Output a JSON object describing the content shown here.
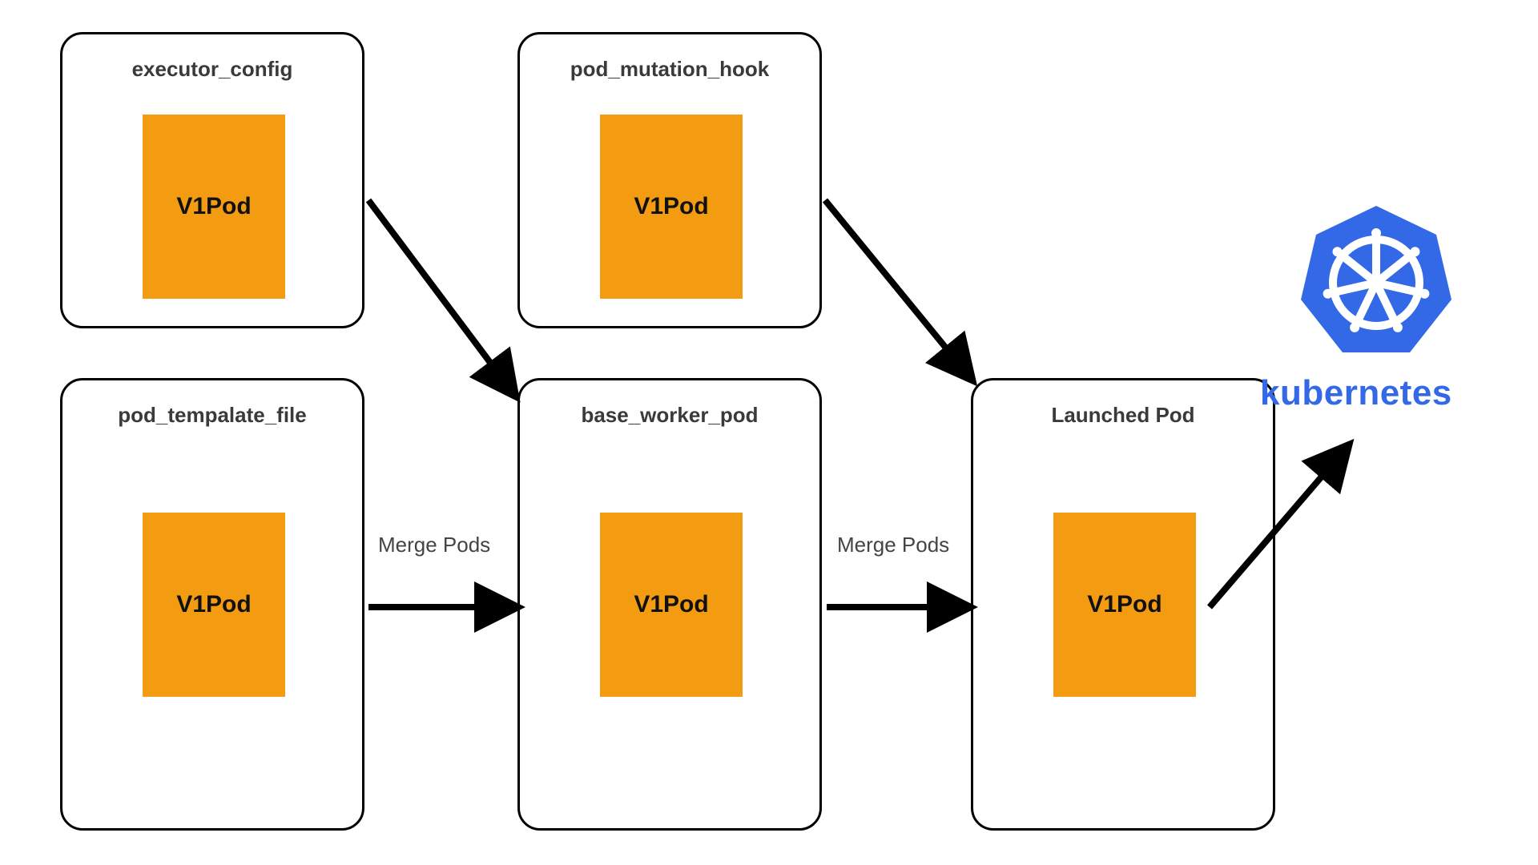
{
  "nodes": {
    "executor_config": {
      "title": "executor_config",
      "pod_label": "V1Pod"
    },
    "pod_mutation_hook": {
      "title": "pod_mutation_hook",
      "pod_label": "V1Pod"
    },
    "pod_template_file": {
      "title": "pod_tempalate_file",
      "pod_label": "V1Pod"
    },
    "base_worker_pod": {
      "title": "base_worker_pod",
      "pod_label": "V1Pod"
    },
    "launched_pod": {
      "title": "Launched Pod",
      "pod_label": "V1Pod"
    }
  },
  "edges": {
    "template_to_base": {
      "label": "Merge Pods"
    },
    "base_to_launched": {
      "label": "Merge Pods"
    }
  },
  "kubernetes": {
    "label": "kubernetes"
  },
  "colors": {
    "pod_fill": "#f39c12",
    "k8s_blue": "#3369e6"
  }
}
